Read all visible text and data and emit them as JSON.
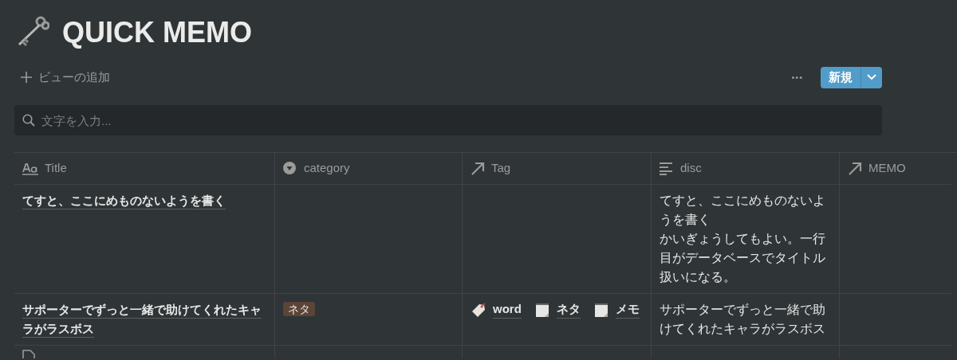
{
  "page": {
    "title": "QUICK MEMO"
  },
  "toolbar": {
    "add_view": "ビューの追加",
    "more": "•••",
    "new_button": "新規"
  },
  "search": {
    "placeholder": "文字を入力..."
  },
  "table": {
    "columns": [
      {
        "label": "Title",
        "kind": "title"
      },
      {
        "label": "category",
        "kind": "select"
      },
      {
        "label": "Tag",
        "kind": "relation"
      },
      {
        "label": "disc",
        "kind": "text"
      },
      {
        "label": "MEMO",
        "kind": "relation"
      }
    ],
    "rows": [
      {
        "title": "てすと、ここにめものないようを書く",
        "category": [],
        "tags": [],
        "disc": [
          "てすと、ここにめものないようを書く",
          "かいぎょうしてもよい。一行目がデータベースでタイトル扱いになる。"
        ]
      },
      {
        "title": "サポーターでずっと一緒で助けてくれたキャラがラスボス",
        "category": [
          "ネタ"
        ],
        "tags": [
          {
            "label": "word",
            "kind": "tag"
          },
          {
            "label": "ネタ",
            "kind": "note"
          },
          {
            "label": "メモ",
            "kind": "note"
          }
        ],
        "disc": [
          "サポーターでずっと一緒で助けてくれたキャラがラスボス"
        ]
      }
    ]
  }
}
